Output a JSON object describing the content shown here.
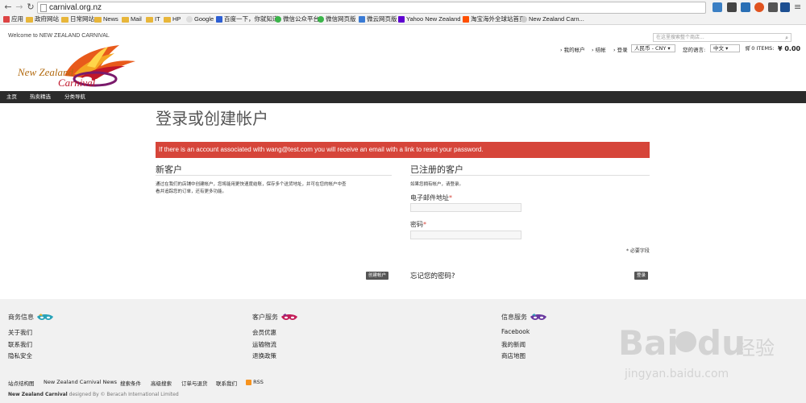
{
  "browser": {
    "url": "carnival.org.nz",
    "bookmarks": [
      "应用",
      "政府网站",
      "日常网站",
      "News",
      "Mail",
      "IT",
      "HP",
      "Google",
      "百度一下，你就知道",
      "微信公众平台",
      "微信网页版",
      "微云网页版",
      "Yahoo New Zealand",
      "淘宝海外全球站首页",
      "New Zealand Carn..."
    ]
  },
  "header": {
    "welcome": "Welcome to NEW ZEALAND CARNIVAL",
    "search_placeholder": "在这里搜索整个商店...",
    "logo_text": "New Zealand Carnival",
    "links": {
      "account": "我的帐户",
      "checkout": "结帐",
      "login": "登录",
      "currency": "人民币 - CNY",
      "language_label": "您的语言:",
      "language": "中文",
      "cart_items": "0 ITEMS:",
      "cart_total": "¥ 0.00"
    }
  },
  "nav": [
    "主页",
    "热卖精选",
    "分类导航"
  ],
  "main": {
    "title": "登录或创建帐户",
    "alert": "If there is an account associated with wang@test.com you will receive an email with a link to reset your password.",
    "new_customer": {
      "title": "新客户",
      "description_line1": "通过在我们的店铺中创建帐户，您将能用更快速度结账，保存多个送货地址，并可在您的帐户中查",
      "description_line2": "看并追踪您的订单，还有更多功能。",
      "create_button": "创建帐户"
    },
    "registered": {
      "title": "已注册的客户",
      "description": "如果您拥有帐户，请登录。",
      "email_label": "电子邮件地址",
      "password_label": "密码",
      "required_asterisk": "*",
      "required_note": "* 必要字段",
      "forgot_link": "忘记您的密码?",
      "login_button": "登录"
    }
  },
  "footer": {
    "columns": [
      {
        "title": "商务信息",
        "links": [
          "关于我们",
          "联系我们",
          "隐私安全"
        ]
      },
      {
        "title": "客户服务",
        "links": [
          "会员优惠",
          "运输物流",
          "退换政策"
        ]
      },
      {
        "title": "信息服务",
        "links": [
          "Facebook",
          "我的新闻",
          "商店地图"
        ]
      }
    ],
    "bottom_links": [
      "站点结构图",
      "New Zealand Carnival News",
      "搜索条件",
      "高级搜索",
      "订单与退货",
      "联系我们",
      "RSS"
    ],
    "credit_brand": "New Zealand Carnival",
    "credit_text": "designed By © Beracah International Limited"
  },
  "watermark": {
    "brand": "Bai",
    "brand2": "du",
    "cn": "经验",
    "url": "jingyan.baidu.com"
  },
  "colors": {
    "alert": "#d6453a",
    "nav": "#2b2b2b",
    "footer": "#f1f1f1"
  }
}
